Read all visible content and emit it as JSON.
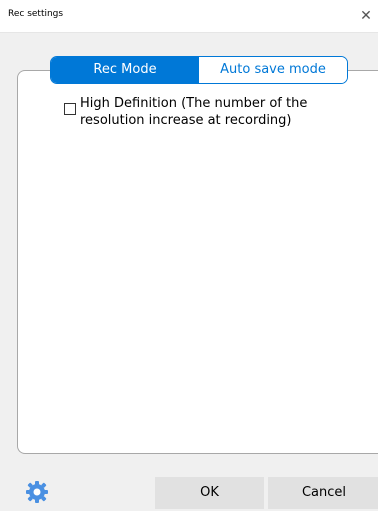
{
  "window": {
    "title": "Rec settings",
    "close_icon": "close-icon"
  },
  "tabs": [
    {
      "label": "Rec Mode",
      "active": true
    },
    {
      "label": "Auto save mode",
      "active": false
    }
  ],
  "options": {
    "high_definition_label": "High Definition (The number of the resolution increase at recording)",
    "high_definition_checked": false
  },
  "footer": {
    "ok_label": "OK",
    "cancel_label": "Cancel",
    "settings_icon": "gear-icon"
  },
  "colors": {
    "accent": "#0078d7"
  }
}
